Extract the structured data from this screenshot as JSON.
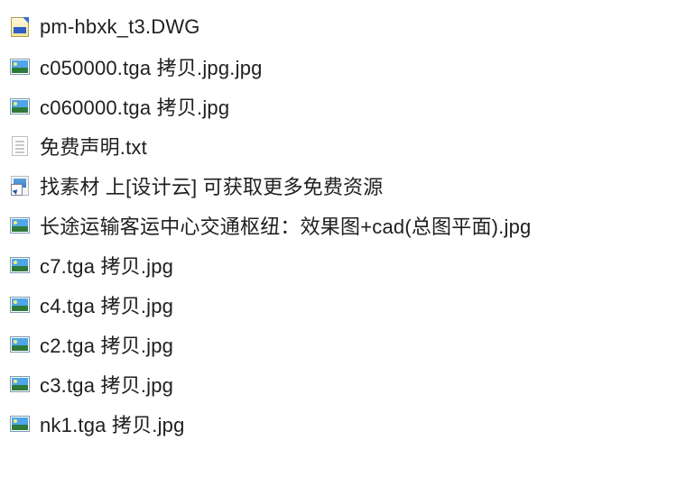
{
  "files": [
    {
      "name": "pm-hbxk_t3.DWG",
      "icon": "dwg"
    },
    {
      "name": "c050000.tga 拷贝.jpg.jpg",
      "icon": "jpg"
    },
    {
      "name": "c060000.tga 拷贝.jpg",
      "icon": "jpg"
    },
    {
      "name": "免费声明.txt",
      "icon": "txt"
    },
    {
      "name": "找素材 上[设计云]  可获取更多免费资源",
      "icon": "shortcut"
    },
    {
      "name": "长途运输客运中心交通枢纽：效果图+cad(总图平面).jpg",
      "icon": "jpg"
    },
    {
      "name": "c7.tga 拷贝.jpg",
      "icon": "jpg"
    },
    {
      "name": "c4.tga 拷贝.jpg",
      "icon": "jpg"
    },
    {
      "name": "c2.tga 拷贝.jpg",
      "icon": "jpg"
    },
    {
      "name": "c3.tga 拷贝.jpg",
      "icon": "jpg"
    },
    {
      "name": "nk1.tga 拷贝.jpg",
      "icon": "jpg"
    }
  ]
}
